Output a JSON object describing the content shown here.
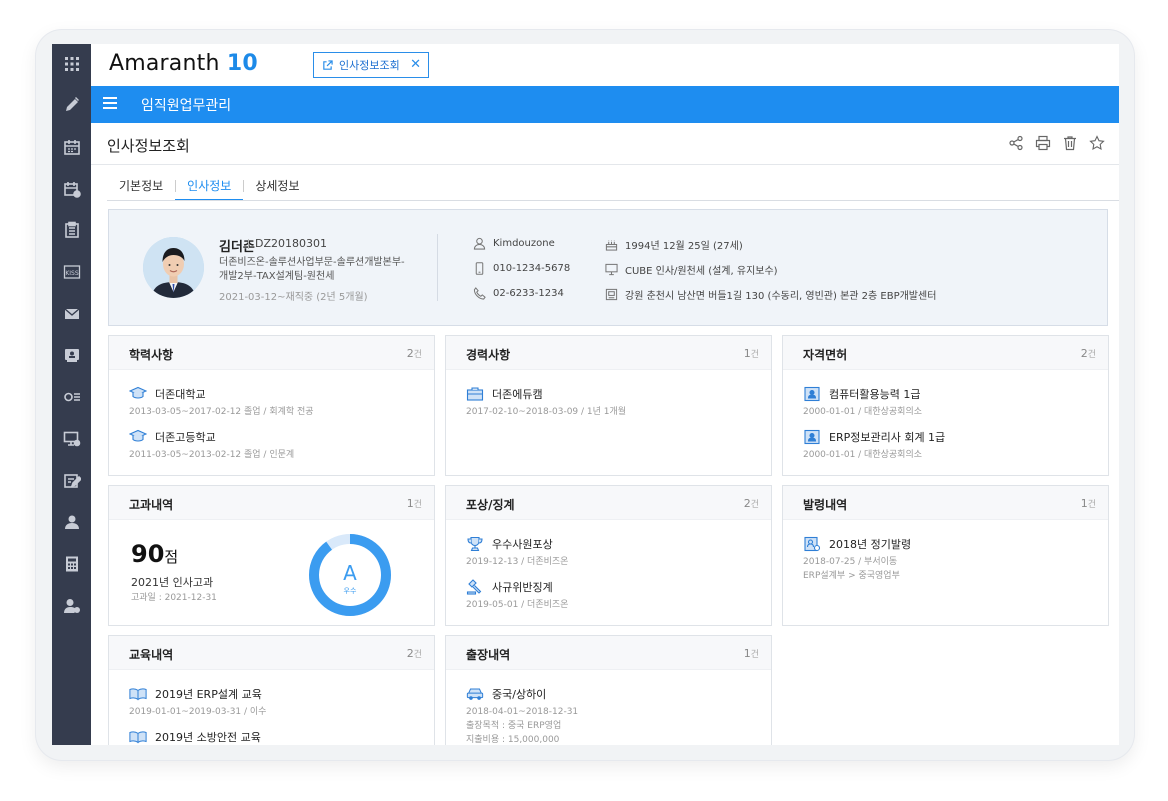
{
  "app": {
    "logo_text": "Amaranth",
    "logo_num": "10"
  },
  "open_tab": {
    "label": "인사정보조회",
    "close": "✕"
  },
  "module_title": "임직원업무관리",
  "page_title": "인사정보조회",
  "tabs": [
    {
      "label": "기본정보"
    },
    {
      "label": "인사정보"
    },
    {
      "label": "상세정보"
    }
  ],
  "profile": {
    "name": "김더존",
    "emp_id": "DZ20180301",
    "dept": "더존비즈온-솔루션사업부문-솔루션개발본부-개발2부-TAX설계팀-원천세",
    "hire": "2021-03-12~재직중 (2년 5개월)",
    "login_id": "Kimdouzone",
    "mobile": "010-1234-5678",
    "phone": "02-6233-1234",
    "birthday": "1994년 12월 25일 (27세)",
    "work": "CUBE 인사/원천세 (설계, 유지보수)",
    "address": "강원 춘천시 남산면 버들1길 130 (수동리, 영빈관) 본관 2층 EBP개발센터"
  },
  "count_unit": "건",
  "cards": {
    "education": {
      "title": "학력사항",
      "count": "2",
      "items": [
        {
          "title": "더존대학교",
          "sub": "2013-03-05~2017-02-12 졸업 / 회계학 전공"
        },
        {
          "title": "더존고등학교",
          "sub": "2011-03-05~2013-02-12 졸업 / 인문계"
        }
      ]
    },
    "career": {
      "title": "경력사항",
      "count": "1",
      "items": [
        {
          "title": "더존에듀캠",
          "sub": "2017-02-10~2018-03-09 / 1년 1개월"
        }
      ]
    },
    "license": {
      "title": "자격면허",
      "count": "2",
      "items": [
        {
          "title": "컴퓨터활용능력 1급",
          "sub": "2000-01-01 / 대한상공회의소"
        },
        {
          "title": "ERP정보관리사 회계 1급",
          "sub": "2000-01-01 / 대한상공회의소"
        }
      ]
    },
    "evaluation": {
      "title": "고과내역",
      "count": "1",
      "score": "90",
      "score_unit": "점",
      "name": "2021년 인사고과",
      "date": "고과일 : 2021-12-31",
      "grade": "A",
      "grade_label": "우수",
      "grade_fraction": 0.9
    },
    "reward": {
      "title": "포상/징계",
      "count": "2",
      "items": [
        {
          "title": "우수사원포상",
          "sub": "2019-12-13 / 더존비즈온"
        },
        {
          "title": "사규위반징계",
          "sub": "2019-05-01 / 더존비즈온"
        }
      ]
    },
    "appointment": {
      "title": "발령내역",
      "count": "1",
      "items": [
        {
          "title": "2018년 정기발령",
          "sub": "2018-07-25 / 부서이동",
          "sub2": "ERP설계부 > 중국영업부"
        }
      ]
    },
    "training": {
      "title": "교육내역",
      "count": "2",
      "items": [
        {
          "title": "2019년 ERP설계 교육",
          "sub": "2019-01-01~2019-03-31 / 이수"
        },
        {
          "title": "2019년 소방안전 교육",
          "sub": ""
        }
      ]
    },
    "trip": {
      "title": "출장내역",
      "count": "1",
      "items": [
        {
          "title": "중국/상하이",
          "sub": "2018-04-01~2018-12-31",
          "sub2": "출장목적 : 중국 ERP영업",
          "sub3": "지출비용 : 15,000,000"
        }
      ]
    }
  },
  "colors": {
    "accent": "#1e8df0",
    "sidebar": "#353c4e",
    "icon_blue": "#2f7fd6"
  }
}
